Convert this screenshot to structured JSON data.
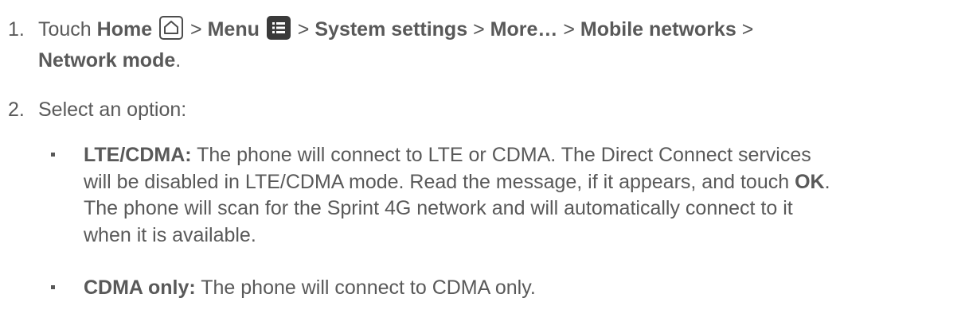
{
  "steps": [
    {
      "number": "1.",
      "touch": "Touch",
      "home": "Home",
      "sep": ">",
      "menu": "Menu",
      "system_settings": "System settings",
      "more": "More…",
      "mobile_networks": "Mobile networks",
      "network_mode": "Network mode",
      "period": "."
    },
    {
      "number": "2.",
      "text": "Select an option:"
    }
  ],
  "options": [
    {
      "label": "LTE/CDMA:",
      "line1": "The phone will connect to LTE or CDMA. The Direct Connect services",
      "line2a": "will be disabled in LTE/CDMA mode. Read the message, if it appears, and touch",
      "ok": "OK",
      "ok_period": ".",
      "line3": "The phone will scan for the Sprint 4G network and will automatically connect to it",
      "line4": "when it is available."
    },
    {
      "label": "CDMA only:",
      "line1": "The phone will connect to CDMA only."
    }
  ],
  "icons": {
    "home": "home-icon",
    "menu": "menu-icon"
  }
}
